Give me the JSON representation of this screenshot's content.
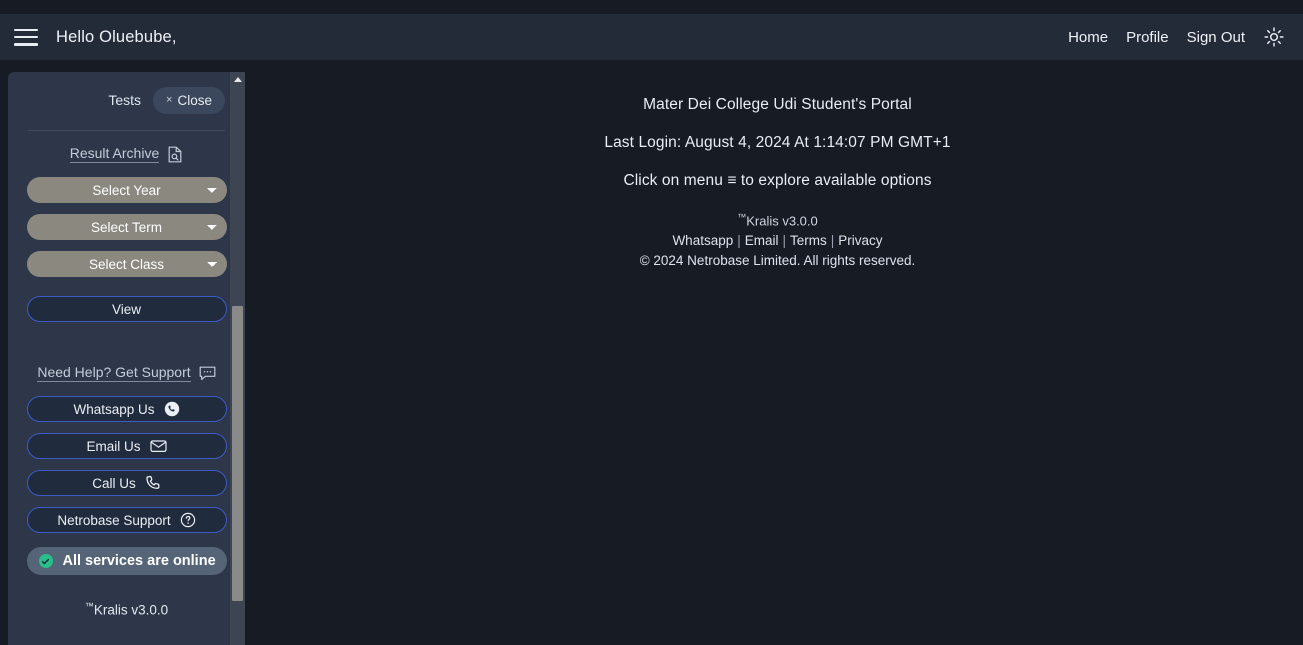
{
  "header": {
    "menu_icon": "hamburger-icon",
    "greeting": "Hello Oluebube,",
    "nav": [
      {
        "label": "Home"
      },
      {
        "label": "Profile"
      },
      {
        "label": "Sign Out"
      }
    ],
    "theme_toggle_icon": "sun-icon"
  },
  "sidebar": {
    "title": "Tests",
    "close_label": "Close",
    "close_x": "×",
    "archive": {
      "label": "Result Archive",
      "icon": "document-search-icon"
    },
    "selects": [
      {
        "name": "select-year",
        "value": "Select Year"
      },
      {
        "name": "select-term",
        "value": "Select Term"
      },
      {
        "name": "select-class",
        "value": "Select Class"
      }
    ],
    "view_label": "View",
    "support": {
      "label": "Need Help? Get Support",
      "icon": "chat-bubble-icon",
      "buttons": [
        {
          "label": "Whatsapp Us",
          "icon": "whatsapp-icon"
        },
        {
          "label": "Email Us",
          "icon": "envelope-icon"
        },
        {
          "label": "Call Us",
          "icon": "phone-icon"
        },
        {
          "label": "Netrobase Support",
          "icon": "question-circle-icon"
        }
      ]
    },
    "status": {
      "label": "All services are online",
      "icon": "check-circle-icon",
      "color": "#27c08a"
    },
    "version": "Kralis v3.0.0",
    "trademark": "™"
  },
  "main": {
    "portal_title": "Mater Dei College Udi Student's Portal",
    "last_login": "Last Login: August 4, 2024 At 1:14:07 PM GMT+1",
    "hint": "Click on menu ≡ to explore available options",
    "footer": {
      "trademark": "™",
      "version": "Kralis v3.0.0",
      "links": [
        {
          "label": "Whatsapp"
        },
        {
          "label": "Email"
        },
        {
          "label": "Terms"
        },
        {
          "label": "Privacy"
        }
      ],
      "separator": "|",
      "copyright": "© 2024 Netrobase Limited. All rights reserved."
    }
  },
  "theme": {
    "page_bg": "#161b24",
    "topbar_bg": "#242b38",
    "sidebar_bg": "#2d3749",
    "accent_border": "#3d5bc4",
    "select_bg": "#8b8880"
  }
}
